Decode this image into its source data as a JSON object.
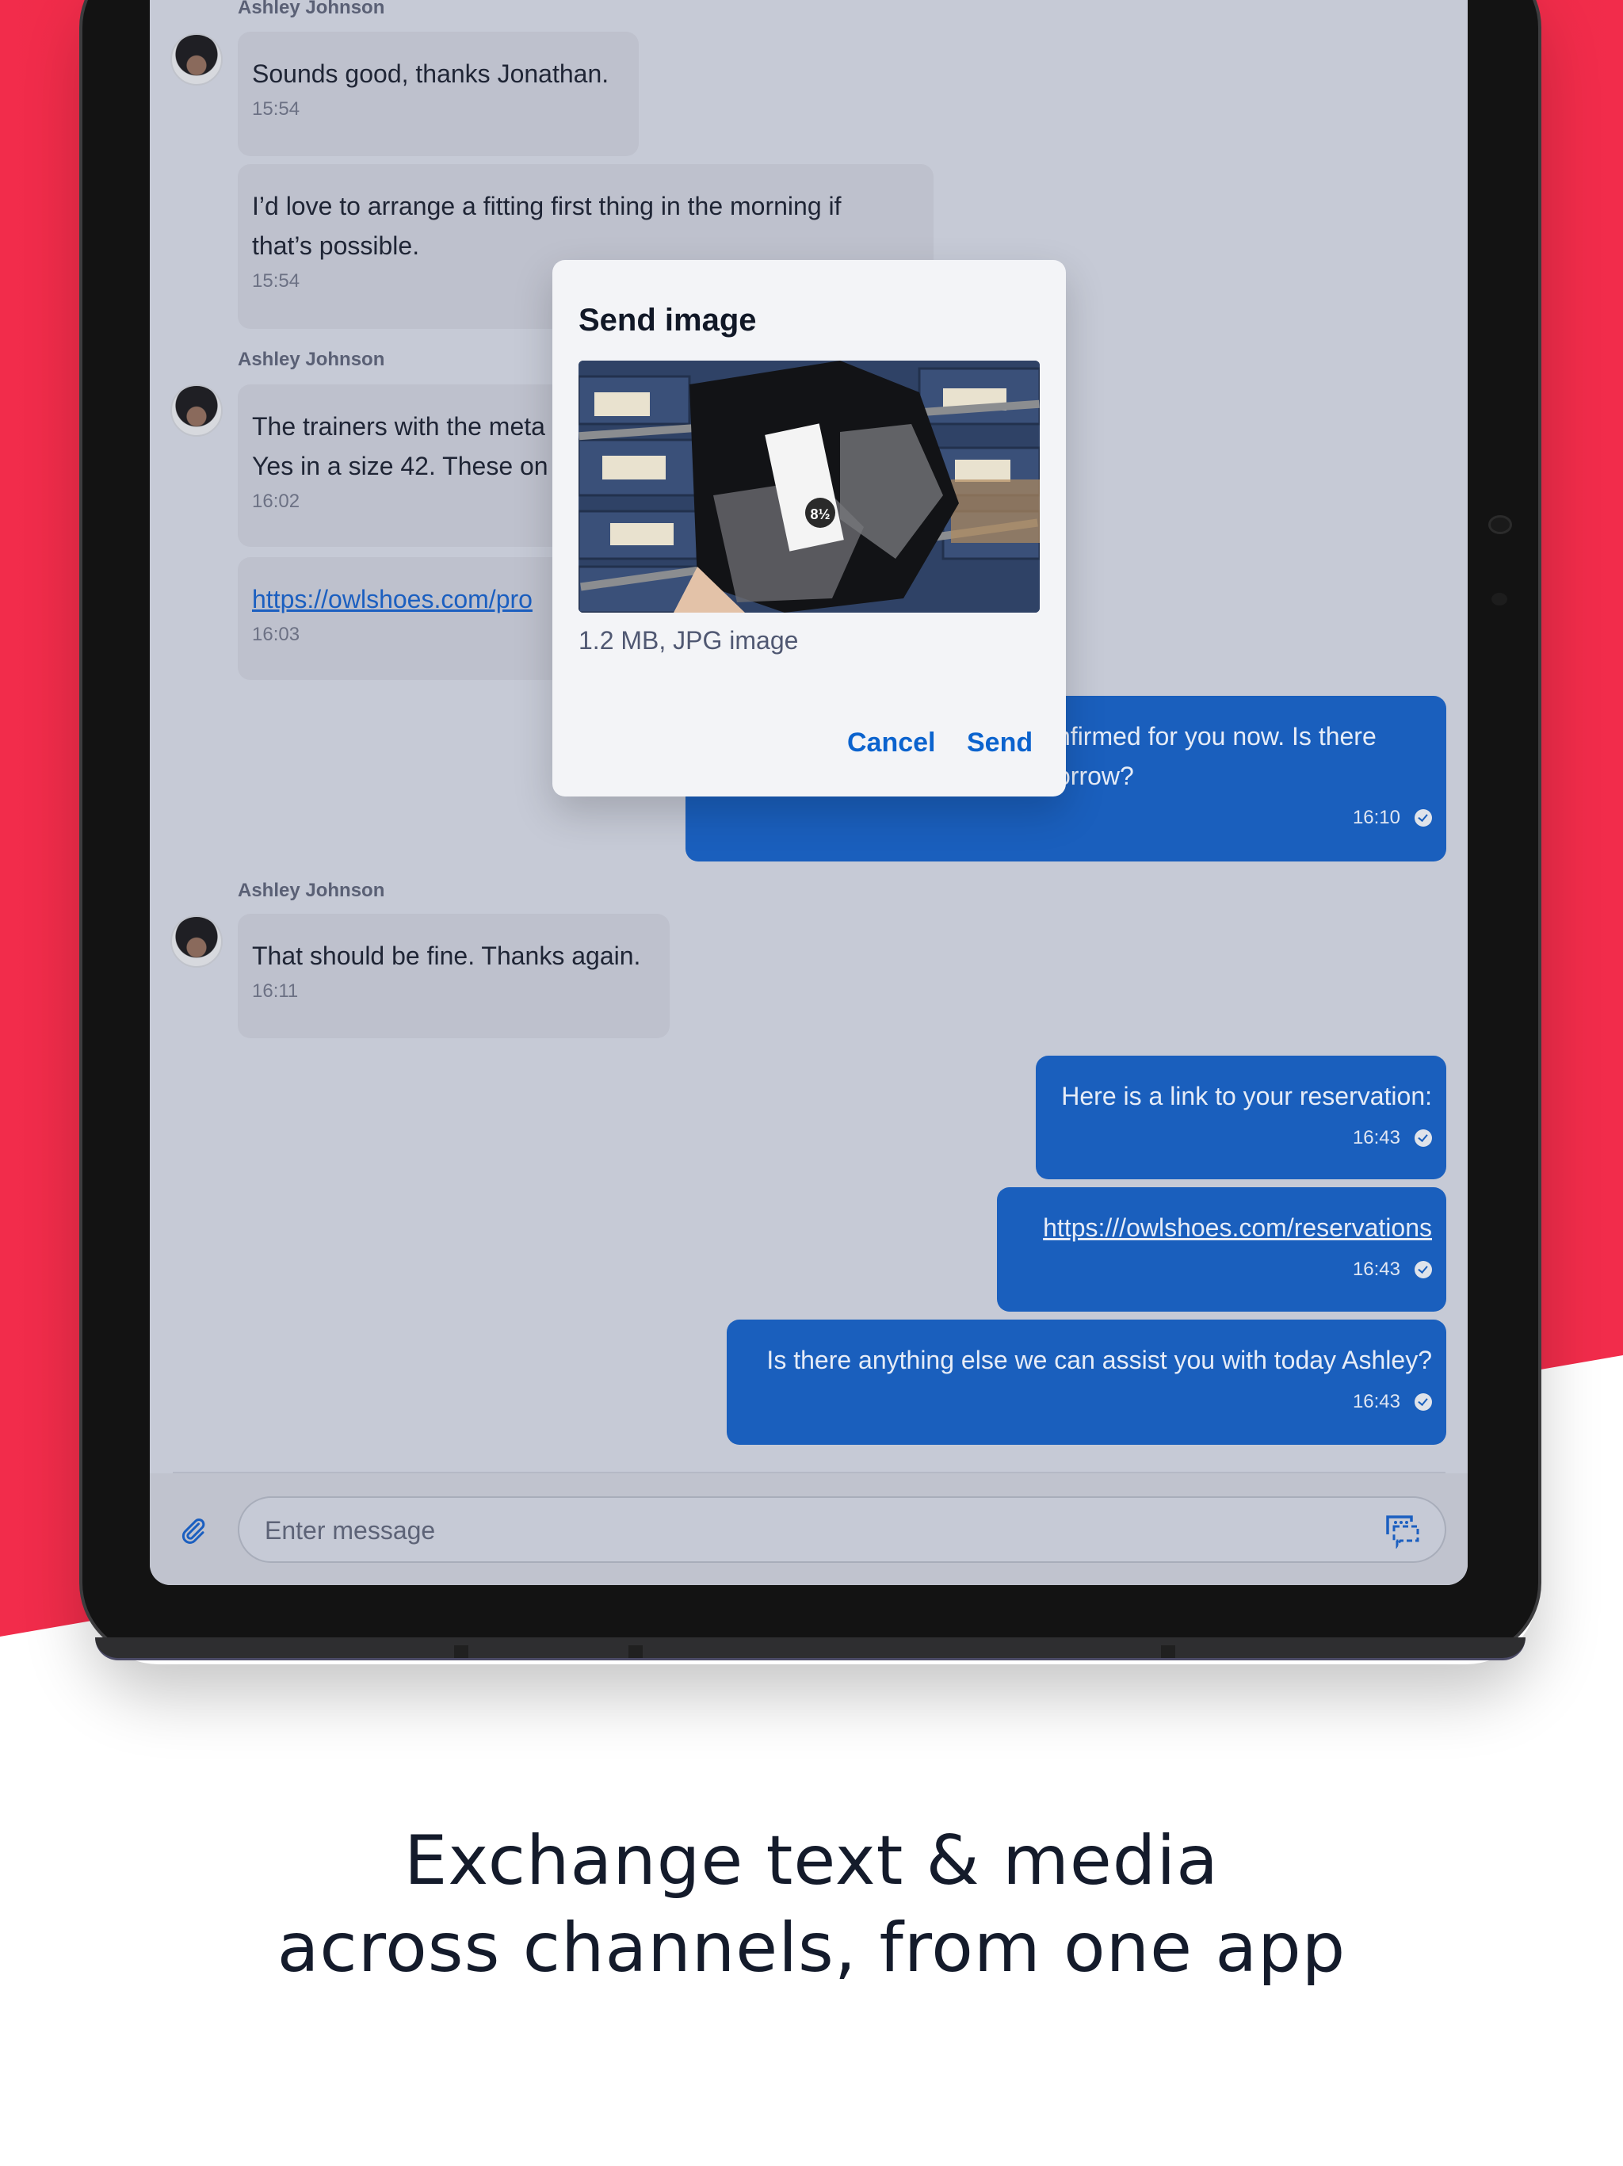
{
  "colors": {
    "brand_red": "#f22c4b",
    "sent_bubble": "#1a5fbd",
    "received_bubble": "#bec1cd",
    "chat_background": "#c6cad6",
    "accent_blue": "#0b63ce"
  },
  "chat": {
    "messages": [
      {
        "direction": "in",
        "sender": "Ashley Johnson",
        "text": "Sounds good, thanks Jonathan.",
        "time": "15:54",
        "show_avatar": true
      },
      {
        "direction": "in",
        "text": "I’d love to arrange a fitting first thing in the morning if\nthat’s possible.",
        "time": "15:54"
      },
      {
        "direction": "in",
        "sender": "Ashley Johnson",
        "text": "The trainers with the meta\nYes in a size 42. These on",
        "time": "16:02",
        "show_avatar": true,
        "partially_hidden": true
      },
      {
        "direction": "in",
        "text": "https://owlshoes.com/pro",
        "time": "16:03",
        "is_link": true,
        "partially_hidden": true
      },
      {
        "direction": "out",
        "text": "nfirmed for you now. Is there\norrow?",
        "time": "16:10",
        "status": "delivered",
        "partially_hidden": true
      },
      {
        "direction": "in",
        "sender": "Ashley Johnson",
        "text": "That should be fine. Thanks again.",
        "time": "16:11",
        "show_avatar": true
      },
      {
        "direction": "out",
        "text": "Here is a link to your reservation:",
        "time": "16:43",
        "status": "delivered"
      },
      {
        "direction": "out",
        "text": "https:///owlshoes.com/reservations",
        "time": "16:43",
        "status": "delivered",
        "is_link": true
      },
      {
        "direction": "out",
        "text": "Is there anything else we can assist you with today Ashley?",
        "time": "16:43",
        "status": "delivered"
      }
    ]
  },
  "composer": {
    "placeholder": "Enter message",
    "value": "",
    "attach_icon": "paperclip-icon",
    "canned_icon": "chat-bubbles-icon"
  },
  "dialog": {
    "title": "Send image",
    "file_meta": "1.2 MB, JPG image",
    "image_alt": "Black mesh trainer with size tag 8½ held in front of shoe boxes",
    "tag_label": "8½",
    "cancel_label": "Cancel",
    "send_label": "Send"
  },
  "caption": {
    "line1": "Exchange text & media",
    "line2": "across channels, from one app"
  }
}
